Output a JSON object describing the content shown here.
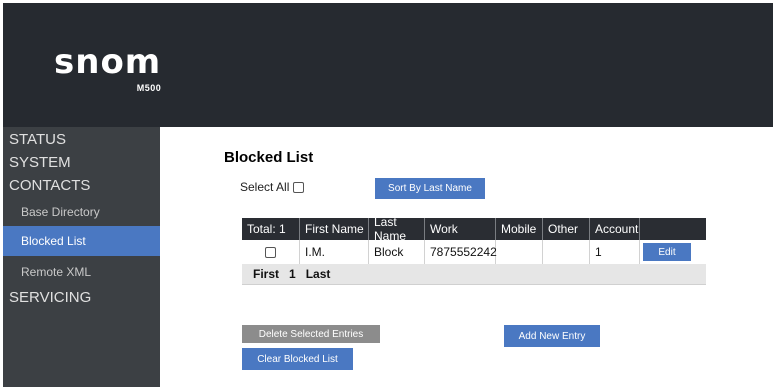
{
  "header": {
    "logo_text": "snom",
    "model": "M500"
  },
  "nav": {
    "status": "STATUS",
    "system": "SYSTEM",
    "contacts": "CONTACTS",
    "base_directory": "Base Directory",
    "blocked_list": "Blocked List",
    "remote_xml": "Remote XML",
    "servicing": "SERVICING"
  },
  "main": {
    "title": "Blocked List",
    "select_all_label": "Select All",
    "sort_button": "Sort By Last Name",
    "table": {
      "headers": [
        "Total: 1",
        "First Name",
        "Last Name",
        "Work",
        "Mobile",
        "Other",
        "Account",
        ""
      ],
      "rows": [
        {
          "first_name": "I.M.",
          "last_name": "Block",
          "work": "7875552242",
          "mobile": "",
          "other": "",
          "account": "1",
          "edit_label": "Edit"
        }
      ],
      "pager": {
        "first": "First",
        "page": "1",
        "last": "Last"
      }
    },
    "delete_button": "Delete Selected Entries",
    "add_button": "Add New Entry",
    "clear_button": "Clear Blocked List"
  },
  "colors": {
    "header_bg": "#262a30",
    "sidebar_bg": "#3c4044",
    "accent": "#4a78c2",
    "gray_button": "#8c8c8c"
  }
}
